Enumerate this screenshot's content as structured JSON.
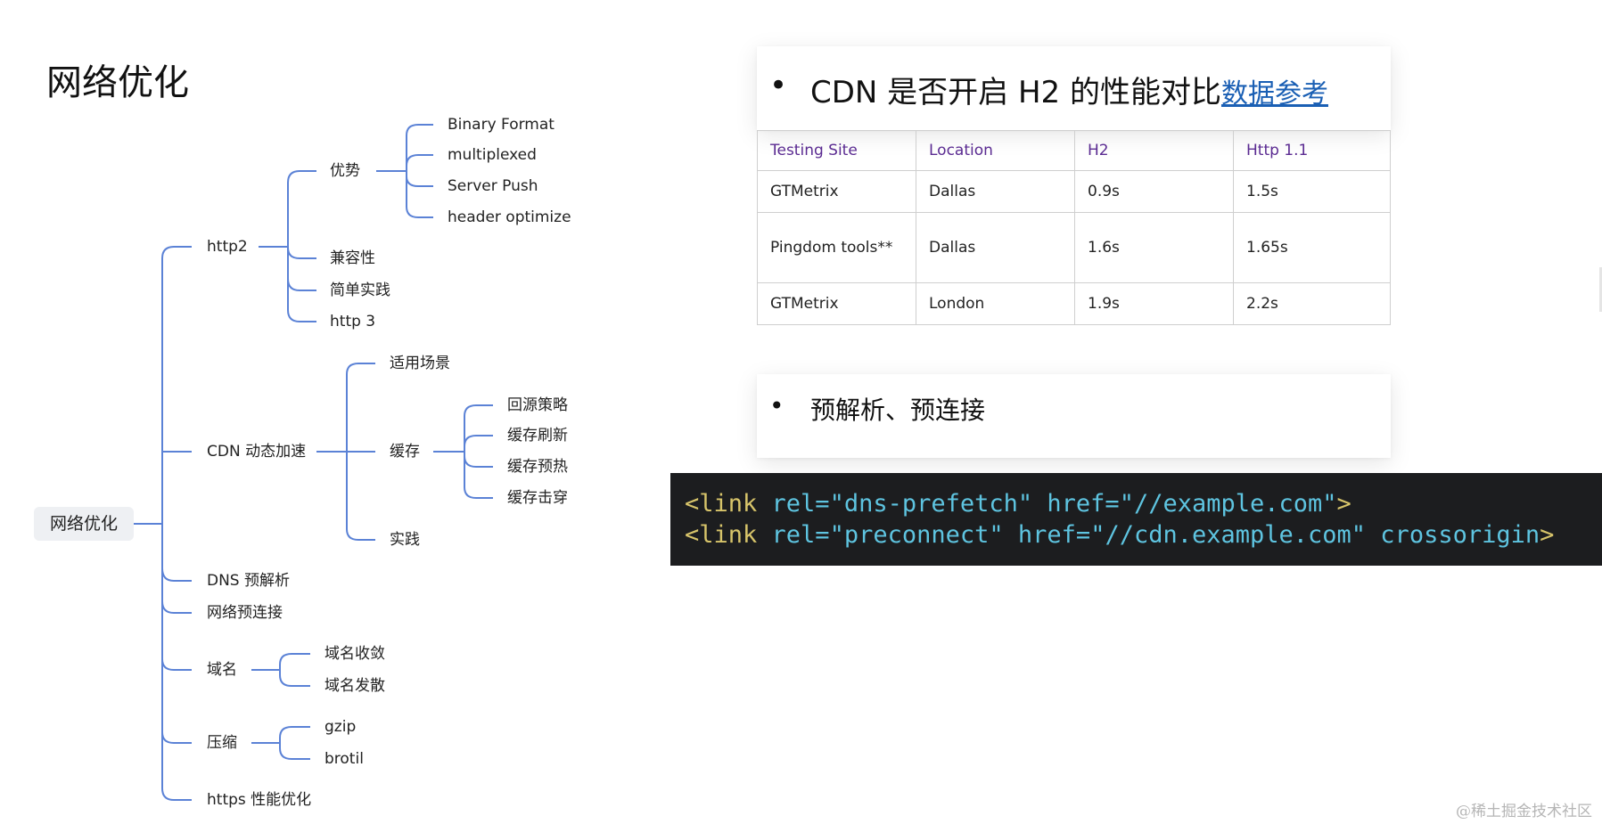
{
  "slide": {
    "title": "网络优化"
  },
  "mindmap": {
    "root": "网络优化",
    "branches": [
      {
        "label": "http2",
        "children": [
          {
            "label": "优势",
            "children": [
              "Binary Format",
              "multiplexed",
              "Server Push",
              "header optimize"
            ]
          },
          {
            "label": "兼容性"
          },
          {
            "label": "简单实践"
          },
          {
            "label": "http 3"
          }
        ]
      },
      {
        "label": "CDN 动态加速",
        "children": [
          {
            "label": "适用场景"
          },
          {
            "label": "缓存",
            "children": [
              "回源策略",
              "缓存刷新",
              "缓存预热",
              "缓存击穿"
            ]
          },
          {
            "label": "实践"
          }
        ]
      },
      {
        "label": "DNS 预解析"
      },
      {
        "label": "网络预连接"
      },
      {
        "label": "域名",
        "children": [
          "域名收敛",
          "域名发散"
        ]
      },
      {
        "label": "压缩",
        "children": [
          "gzip",
          "brotil"
        ]
      },
      {
        "label": "https 性能优化"
      }
    ]
  },
  "cdn_card": {
    "bullet": "•",
    "heading": "CDN 是否开启 H2 的性能对比",
    "link": "数据参考"
  },
  "perf_table": {
    "headers": [
      "Testing Site",
      "Location",
      "H2",
      "Http 1.1"
    ],
    "rows": [
      [
        "GTMetrix",
        "Dallas",
        "0.9s",
        "1.5s"
      ],
      [
        "Pingdom tools**",
        "Dallas",
        "1.6s",
        "1.65s"
      ],
      [
        "GTMetrix",
        "London",
        "1.9s",
        "2.2s"
      ]
    ]
  },
  "preresolve_card": {
    "bullet": "•",
    "heading": "预解析、预连接"
  },
  "code": {
    "line1": {
      "open": "<link",
      "attr1": " rel=",
      "val1": "\"dns-prefetch\"",
      "attr2": " href=",
      "val2": "\"//example.com\"",
      "close": ">"
    },
    "line2": {
      "open": "<link",
      "attr1": " rel=",
      "val1": "\"preconnect\"",
      "attr2": " href=",
      "val2": "\"//cdn.example.com\"",
      "attr3": " crossorigin",
      "close": ">"
    }
  },
  "footer": {
    "credit": "@稀土掘金技术社区"
  },
  "colors": {
    "connector": "#5b82d6",
    "table_header": "#5a2a91",
    "link": "#1a5fb4",
    "code_bg": "#1c1d1f",
    "code_tag": "#d7c46a",
    "code_attr": "#5ec4e0"
  }
}
